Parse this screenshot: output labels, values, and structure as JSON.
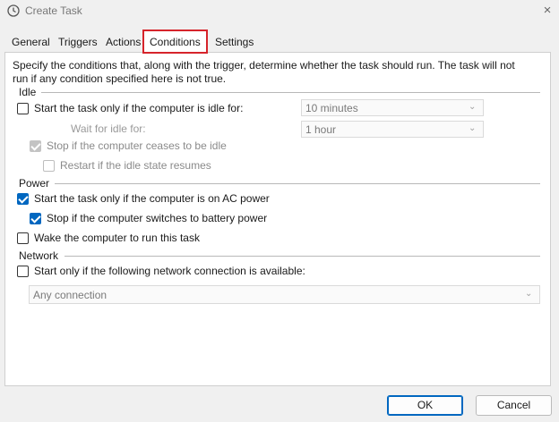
{
  "window": {
    "title": "Create Task",
    "close_icon": "×"
  },
  "tabs": [
    {
      "label": "General"
    },
    {
      "label": "Triggers"
    },
    {
      "label": "Actions"
    },
    {
      "label": "Conditions",
      "selected": true
    },
    {
      "label": "Settings"
    }
  ],
  "conditions": {
    "description_line1": "Specify the conditions that, along with the trigger, determine whether the task should run.  The task will not",
    "description_line2": "run  if any condition specified here is not true.",
    "idle": {
      "heading": "Idle",
      "start_only_if_idle": {
        "label": "Start the task only if the computer is idle for:",
        "checked": false
      },
      "idle_for_value": "10 minutes",
      "wait_for_idle_label": "Wait for idle for:",
      "wait_for_idle_value": "1 hour",
      "stop_if_ceases_idle": {
        "label": "Stop if the computer ceases to be idle",
        "checked": true,
        "disabled": true
      },
      "restart_if_idle_resumes": {
        "label": "Restart if the idle state resumes",
        "checked": false,
        "disabled": true
      }
    },
    "power": {
      "heading": "Power",
      "start_only_on_ac": {
        "label": "Start the task only if the computer is on AC power",
        "checked": true
      },
      "stop_on_battery": {
        "label": "Stop if the computer switches to battery power",
        "checked": true
      },
      "wake_to_run": {
        "label": "Wake the computer to run this task",
        "checked": false
      }
    },
    "network": {
      "heading": "Network",
      "start_only_if_network": {
        "label": "Start only if the following network connection is available:",
        "checked": false
      },
      "connection_value": "Any connection"
    }
  },
  "buttons": {
    "ok": "OK",
    "cancel": "Cancel"
  },
  "colors": {
    "accent": "#0067c0",
    "highlight_border": "#d6242b"
  }
}
